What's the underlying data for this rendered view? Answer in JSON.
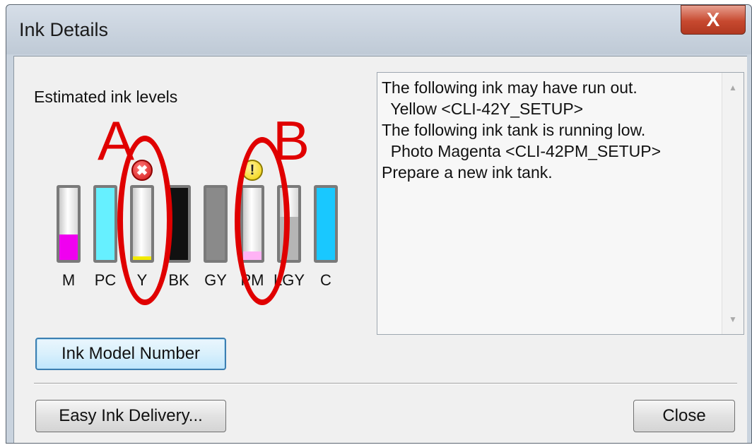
{
  "window": {
    "title": "Ink Details",
    "close_glyph": "X"
  },
  "panel": {
    "estimated_label": "Estimated ink levels"
  },
  "tanks": [
    {
      "code": "M",
      "color": "#f000f0",
      "level": 0.35
    },
    {
      "code": "PC",
      "color": "#66f0ff",
      "level": 1.0
    },
    {
      "code": "Y",
      "color": "#f2ea00",
      "level": 0.05,
      "status": "error-icon"
    },
    {
      "code": "BK",
      "color": "#111111",
      "level": 1.0
    },
    {
      "code": "GY",
      "color": "#8a8a8a",
      "level": 1.0
    },
    {
      "code": "PM",
      "color": "#ffb3f5",
      "level": 0.12,
      "status": "warning-icon"
    },
    {
      "code": "LGY",
      "color": "#b5b5b5",
      "level": 0.6
    },
    {
      "code": "C",
      "color": "#19c8ff",
      "level": 1.0
    }
  ],
  "annotations": {
    "a_label": "A",
    "b_label": "B",
    "color": "#e00000"
  },
  "status_icons": {
    "error_glyph": "✖",
    "warning_glyph": "!"
  },
  "message": {
    "lines": [
      "The following ink may have run out.",
      "  Yellow <CLI-42Y_SETUP>",
      "The following ink tank is running low.",
      "  Photo Magenta <CLI-42PM_SETUP>",
      "Prepare a new ink tank."
    ]
  },
  "buttons": {
    "ink_model_number": "Ink Model Number",
    "easy_ink_delivery": "Easy Ink Delivery...",
    "close": "Close"
  }
}
